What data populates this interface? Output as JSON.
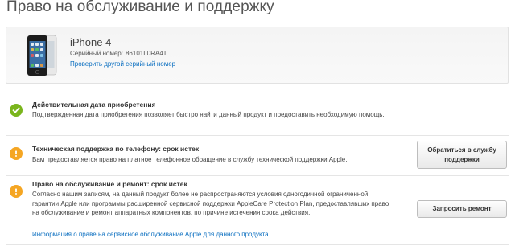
{
  "page": {
    "title": "Право на обслуживание и поддержку"
  },
  "product": {
    "name": "iPhone 4",
    "serial_label": "Серийный номер:",
    "serial_value": "86101L0RA4T",
    "check_other_link": "Проверить другой серийный номер"
  },
  "sections": [
    {
      "status": "valid",
      "icon": "check-icon",
      "color": "#7ab51d",
      "title": "Действительная дата приобретения",
      "text": "Подтвержденная дата приобретения позволяет быстро найти данный продукт и предоставить необходимую помощь."
    },
    {
      "status": "expired",
      "icon": "warning-icon",
      "color": "#f5a623",
      "title": "Техническая поддержка по телефону: срок истек",
      "text": "Вам предоставляется право на платное телефонное обращение в службу технической поддержки Apple.",
      "button": "Обратиться в службу поддержки"
    },
    {
      "status": "expired",
      "icon": "warning-icon",
      "color": "#f5a623",
      "title": "Право на обслуживание и ремонт: срок истек",
      "text": "Согласно нашим записям, на данный продукт более не распространяются условия одногодичной ограниченной гарантии Apple или программы расширенной сервисной поддержки AppleCare Protection Plan, предоставлявших право на обслуживание и ремонт аппаратных компонентов, по причине истечения срока действия.",
      "link": "Информация о праве на сервисное обслуживание Apple для данного продукта.",
      "button": "Запросить ремонт"
    }
  ]
}
